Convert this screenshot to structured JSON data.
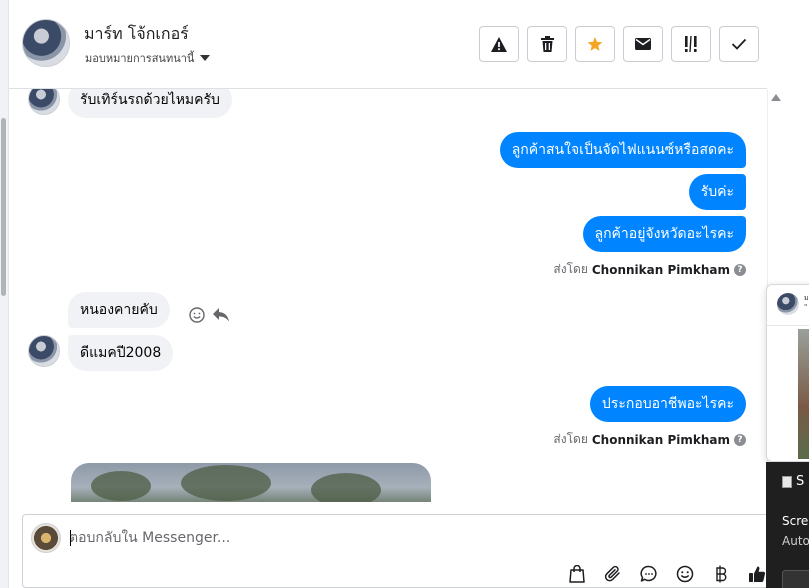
{
  "header": {
    "name": "มาร์ท โจ้กเกอร์",
    "assign_label": "มอบหมายการสนทนานี้",
    "actions": [
      {
        "name": "report-button",
        "icon": "warning-icon"
      },
      {
        "name": "delete-button",
        "icon": "trash-icon"
      },
      {
        "name": "star-button",
        "icon": "star-icon",
        "color": "#f5a623"
      },
      {
        "name": "email-button",
        "icon": "envelope-icon"
      },
      {
        "name": "priority-button",
        "icon": "priority-icon"
      },
      {
        "name": "done-button",
        "icon": "check-icon"
      }
    ]
  },
  "messages": {
    "m1": "รับเทิร์นรถด้วยไหมครับ",
    "m2": "ลูกค้าสนใจเป็นจัดไฟแนนซ์หรือสดคะ",
    "m3": "รับค่ะ",
    "m4": "ลูกค้าอยู่จังหวัดอะไรคะ",
    "sent_by_label": "ส่งโดย",
    "sender": "Chonnikan Pimkham",
    "help": "?",
    "m5": "หนองคายคับ",
    "m6": "ดีแมคปี2008",
    "m7": "ประกอบอาชีพอะไรคะ"
  },
  "composer": {
    "placeholder": "ตอบกลับใน Messenger...",
    "tools": [
      "bag-icon",
      "paperclip-icon",
      "chat-bubble-icon",
      "emoji-icon",
      "baht-icon",
      "thumbs-up-icon"
    ]
  },
  "popup": {
    "name": "ม",
    "sub": "\""
  },
  "toast": {
    "title": "S",
    "line1": "Scre",
    "line2": "Auto"
  },
  "colors": {
    "outgoing": "#0084ff",
    "incoming": "#f0f2f5",
    "star": "#f5a623"
  }
}
